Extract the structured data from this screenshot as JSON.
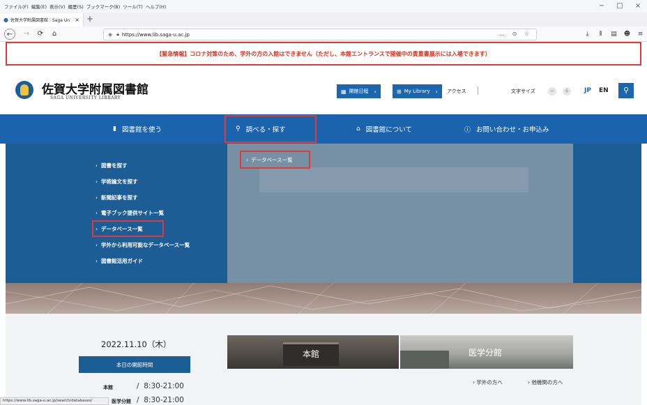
{
  "browser": {
    "menu": [
      "ファイル(F)",
      "編集(E)",
      "表示(V)",
      "履歴(S)",
      "ブックマーク(B)",
      "ツール(T)",
      "ヘルプ(H)"
    ],
    "window_controls": [
      "−",
      "□",
      "×"
    ],
    "tab_title": "佐賀大学附属図書館｜Saga Un",
    "tab_close": "×",
    "new_tab": "+",
    "nav": {
      "back": "←",
      "forward": "→",
      "reload": "⟳",
      "home": "⌂"
    },
    "url": "https://www.lib.saga-u.ac.jp",
    "url_actions": "… ⊙ ☆",
    "tools": [
      "⤓",
      "⫴",
      "▤",
      "☻",
      "≡"
    ],
    "status_url": "https://www.lib.saga-u.ac.jp/search/databases/"
  },
  "alert": {
    "text": "【緊急情報】コロナ対策のため、学外の方の入館はできません（ただし、本館エントランスで開催中の貴重書展示には入場できます）"
  },
  "header": {
    "title": "佐賀大学附属図書館",
    "subtitle": "SAGA UNIVERSITY LIBRARY",
    "calendar_btn": "開館日程",
    "mylibrary_btn": "My Library",
    "access": "アクセス",
    "font_size": "文字サイズ",
    "font_minus": "−",
    "font_plus": "＋",
    "lang_jp": "JP",
    "lang_en": "EN",
    "chev": "›"
  },
  "mainnav": [
    {
      "label": "図書館を使う",
      "icon": "book-icon"
    },
    {
      "label": "調べる・探す",
      "icon": "search-icon"
    },
    {
      "label": "図書館について",
      "icon": "building-icon"
    },
    {
      "label": "お問い合わせ・お申込み",
      "icon": "question-icon"
    }
  ],
  "dropdown": {
    "items": [
      "図書を探す",
      "学術論文を探す",
      "新聞記事を探す",
      "電子ブック提供サイト一覧",
      "データベース一覧",
      "学外から利用可能なデータベース一覧",
      "図書館活用ガイド"
    ],
    "sub_item": "データベース一覧",
    "chev": "›"
  },
  "info": {
    "date": "2022.11.10（木）",
    "hours_heading": "本日の開館時間",
    "rows": [
      {
        "name": "本館",
        "sep": "/",
        "time": "8:30-21:00"
      },
      {
        "name": "医学分館",
        "sep": "/",
        "time": "8:30-21:00"
      }
    ]
  },
  "campus": {
    "main": "本館",
    "medical": "医学分館",
    "link_outside": "学外の方へ",
    "link_other": "他機関の方へ",
    "chev": "›"
  },
  "colors": {
    "primary": "#1b64ad",
    "alert": "#d6331f",
    "highlight": "#e03a3a"
  }
}
